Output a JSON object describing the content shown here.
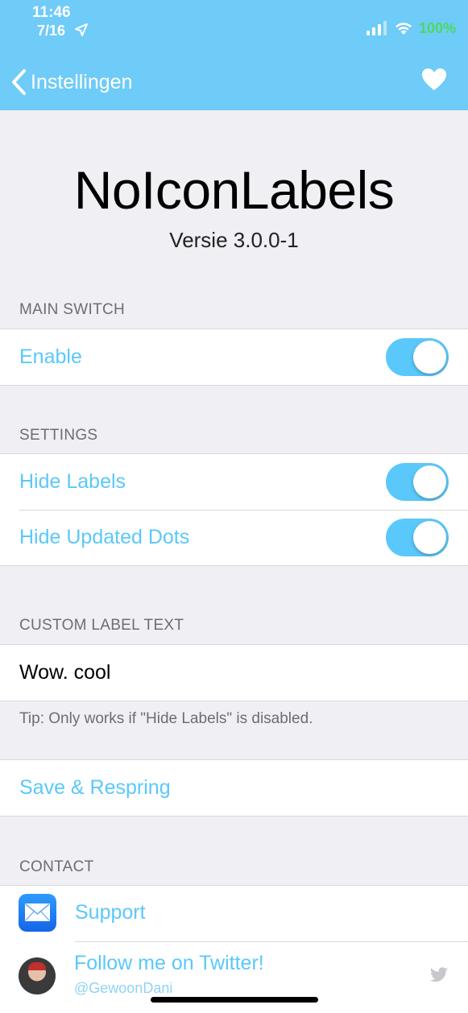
{
  "status_bar": {
    "time": "11:46",
    "date": "7/16",
    "battery": "100%"
  },
  "nav": {
    "back_label": "Instellingen"
  },
  "header": {
    "title": "NoIconLabels",
    "version": "Versie 3.0.0-1"
  },
  "sections": {
    "main_switch": {
      "header": "MAIN SWITCH",
      "enable_label": "Enable",
      "enable_on": true
    },
    "settings": {
      "header": "SETTINGS",
      "hide_labels_label": "Hide Labels",
      "hide_dots_label": "Hide Updated Dots"
    },
    "custom_label": {
      "header": "CUSTOM LABEL TEXT",
      "value": "Wow. cool",
      "tip": "Tip: Only works if \"Hide Labels\" is disabled."
    },
    "respring": {
      "label": "Save & Respring"
    },
    "contact": {
      "header": "CONTACT",
      "support_label": "Support",
      "twitter_title": "Follow me on Twitter!",
      "twitter_handle": "@GewoonDani"
    }
  },
  "colors": {
    "nav_bar": "#6fcbf7",
    "accent": "#5ac8fa",
    "battery": "#4cd964",
    "background": "#efeff4"
  }
}
